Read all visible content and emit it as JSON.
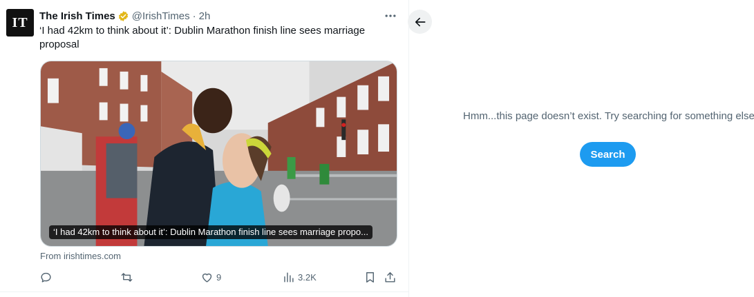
{
  "tweet": {
    "avatar_text": "IT",
    "display_name": "The Irish Times",
    "handle": "@IrishTimes",
    "separator": "·",
    "time": "2h",
    "text": "‘I had 42km to think about it’: Dublin Marathon finish line sees marriage proposal",
    "card_caption": "‘I had 42km to think about it’: Dublin Marathon finish line sees marriage propo...",
    "source": "From irishtimes.com",
    "actions": {
      "reply_count": "",
      "retweet_count": "",
      "like_count": "9",
      "views_count": "3.2K"
    }
  },
  "right_panel": {
    "message": "Hmm...this page doesn’t exist. Try searching for something else.",
    "search_label": "Search"
  },
  "colors": {
    "accent": "#1d9bf0",
    "verified_gold": "#e2b719",
    "secondary_text": "#536471"
  },
  "icons": [
    "more-icon",
    "verified-badge-icon",
    "reply-icon",
    "retweet-icon",
    "like-icon",
    "views-icon",
    "bookmark-icon",
    "share-icon",
    "back-arrow-icon"
  ]
}
